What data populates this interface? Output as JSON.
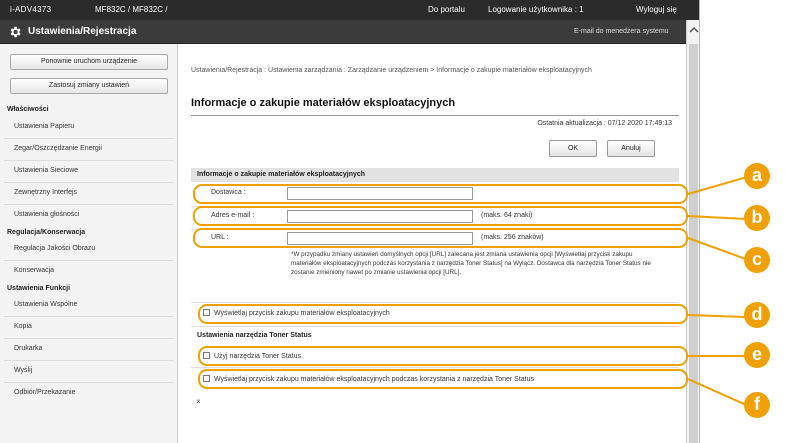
{
  "topbar": {
    "device": "i-ADV4373",
    "path": "MF832C / MF832C /",
    "portal": "Do portalu",
    "user": "Logowanie użytkownika :  1",
    "logout": "Wyloguj się"
  },
  "header": {
    "title": "Ustawienia/Rejestracja",
    "email": "E-mail do menedżera systemu",
    "icon": "gear-icon"
  },
  "sidebar": {
    "buttons": [
      "Ponownie uruchom urządzenie",
      "Zastosuj zmiany ustawień"
    ],
    "sections": [
      {
        "title": "Właściwości",
        "items": [
          "Ustawienia Papieru",
          "Zegar/Oszczędzanie Energii",
          "Ustawienia Sieciowe",
          "Zewnętrzny Interfejs",
          "Ustawienia głośności"
        ]
      },
      {
        "title": "Regulacja/Konserwacja",
        "items": [
          "Regulacja Jakości Obrazu",
          "Konserwacja"
        ]
      },
      {
        "title": "Ustawienia Funkcji",
        "items": [
          "Ustawienia Wspólne",
          "Kopia",
          "Drukarka",
          "Wyślij",
          "Odbiór/Przekazanie"
        ]
      }
    ]
  },
  "main": {
    "breadcrumb": "Ustawienia/Rejestracja : Ustawienia zarządzania : Zarządzanie urządzeniem > Informacje o zakupie materiałów eksploatacyjnych",
    "title": "Informacje o zakupie materiałów eksploatacyjnych",
    "updated": "Ostatnia aktualizacja : 07/12 2020 17:49:13",
    "ok_label": "OK",
    "cancel_label": "Anuluj",
    "section_title": "Informacje o zakupie materiałów eksploatacyjnych",
    "fields": {
      "supplier_label": "Dostawca :",
      "supplier_value": "",
      "email_label": "Adres e-mail :",
      "email_value": "",
      "email_hint": "(maks. 64 znaki)",
      "url_label": "URL :",
      "url_value": "",
      "url_hint": "(maks. 256 znaków)"
    },
    "note": "*W przypadku zmiany ustawień domyślnych opcji [URL] zalecana jest zmiana ustawienia opcji [Wyświetlaj przycisk zakupu materiałów eksploatacyjnych podczas korzystania z narzędzia Toner Status] na Wyłącz. Dostawca dla narzędzia Toner Status nie zostanie zmieniony nawet po zmianie ustawienia opcji [URL].",
    "check_display_purchase": "Wyświetlaj przycisk zakupu materiałów eksploatacyjnych",
    "toner_section_title": "Ustawienia narzędzia Toner Status",
    "check_use_toner_status": "Użyj narzędzia Toner Status",
    "check_display_toner_purchase": "Wyświetlaj przycisk zakupu materiałów eksploatacyjnych podczas korzystania z narzędzia Toner Status",
    "to_top": "⌅"
  },
  "callouts": [
    "a",
    "b",
    "c",
    "d",
    "e",
    "f"
  ],
  "colors": {
    "callout": "#f0a000",
    "topbar": "#2b2b2b",
    "header": "#3b3b3b"
  }
}
